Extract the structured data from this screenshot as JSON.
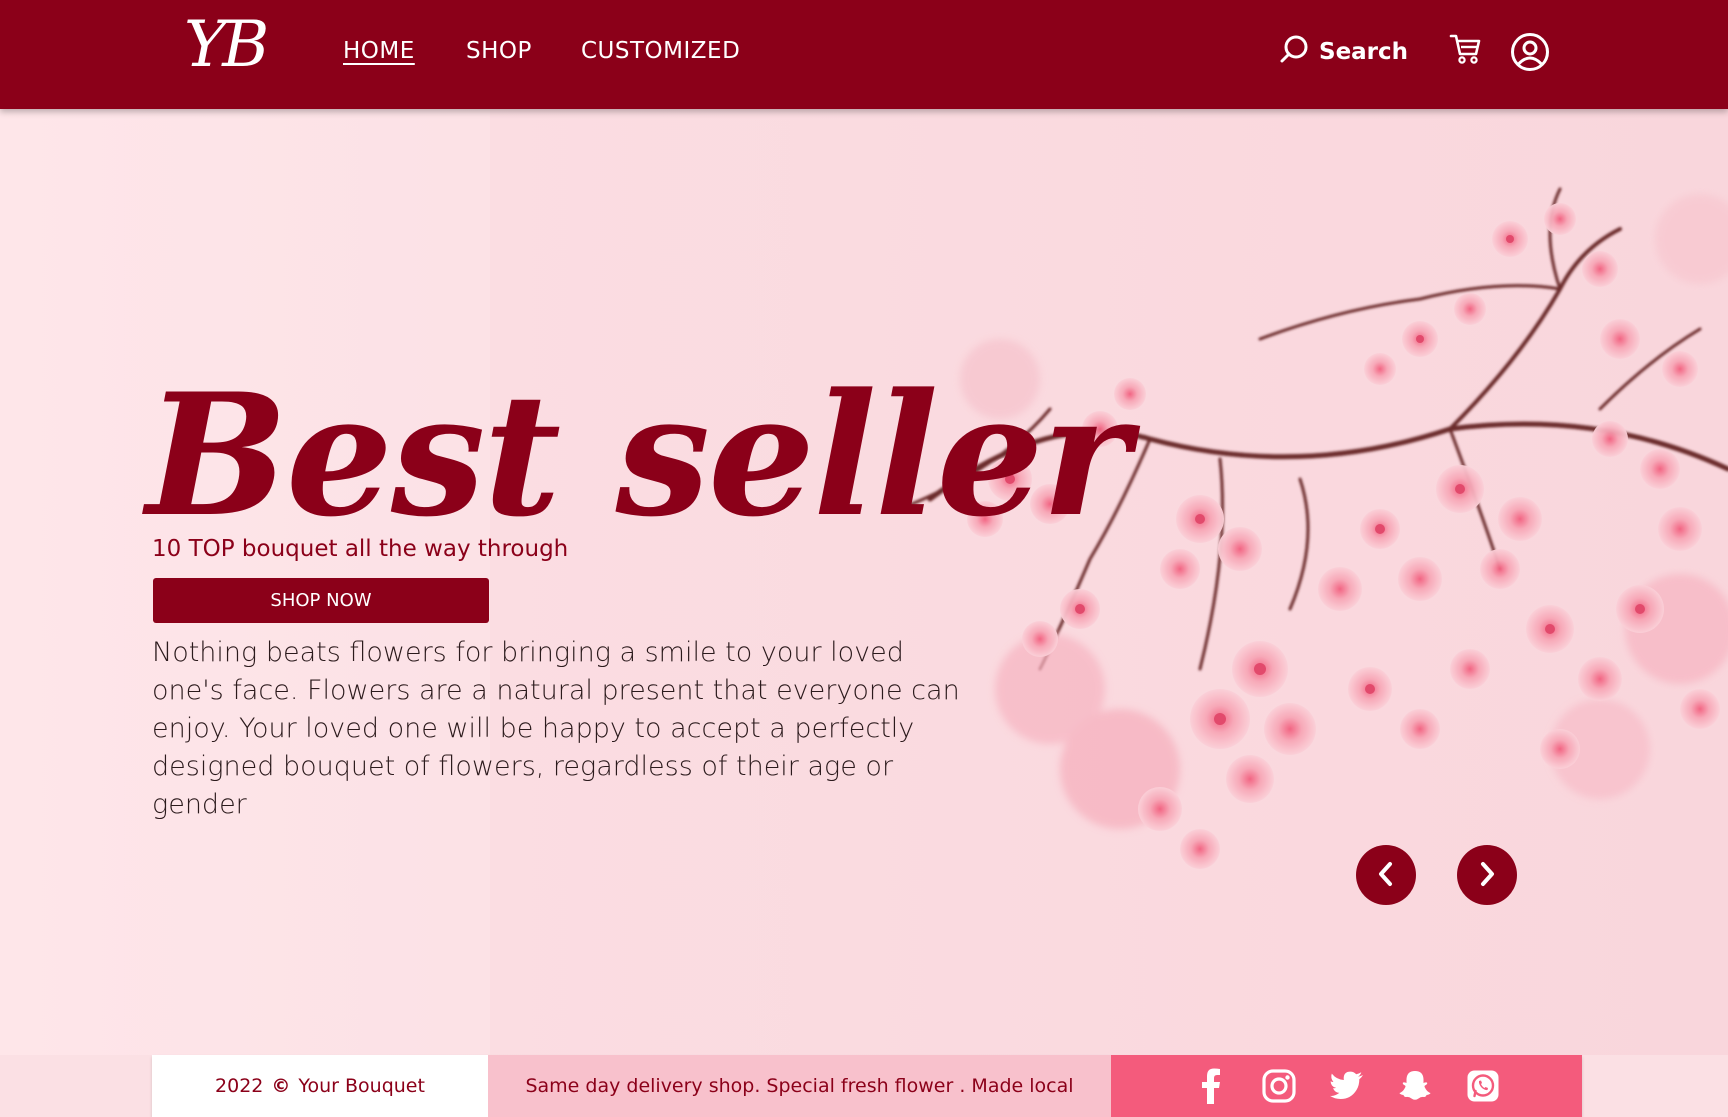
{
  "brand": {
    "logo_text": "YB"
  },
  "nav": {
    "links": [
      {
        "label": "HOME",
        "active": true
      },
      {
        "label": "SHOP",
        "active": false
      },
      {
        "label": "CUSTOMIZED",
        "active": false
      }
    ],
    "search_label": "Search"
  },
  "hero": {
    "title": "Best seller",
    "subtitle": "10 TOP  bouquet all the way through",
    "cta_label": "SHOP NOW",
    "description": "Nothing beats flowers for bringing a smile to your loved one's face. Flowers are a natural present that everyone can enjoy. Your loved one will be happy to accept a perfectly designed bouquet of flowers, regardless of their age or gender"
  },
  "footer": {
    "year": "2022",
    "copyright_symbol": "©",
    "company": "Your Bouquet",
    "tagline": "Same day delivery shop. Special fresh flower . Made local",
    "social": [
      "facebook-icon",
      "instagram-icon",
      "twitter-icon",
      "snapchat-icon",
      "whatsapp-icon"
    ]
  },
  "colors": {
    "primary": "#8b0019",
    "hero_bg": "#fbdde2",
    "footer_tag_bg": "#f8c1cc",
    "footer_social_bg": "#f45b7c"
  }
}
